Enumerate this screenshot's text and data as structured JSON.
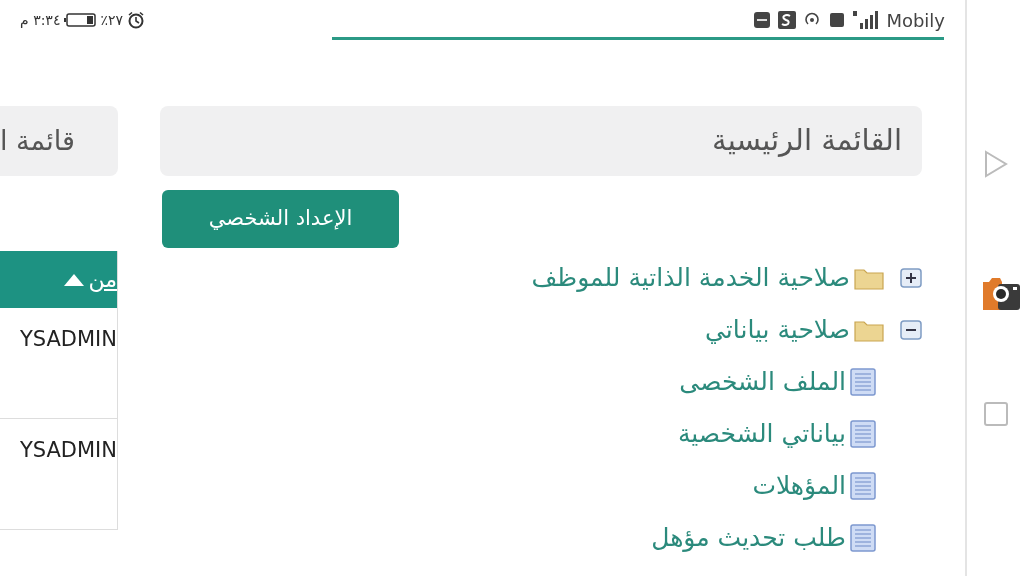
{
  "status_bar": {
    "time": "٣:٣٤ م",
    "battery": "٪٢٧",
    "carrier": "Mobily"
  },
  "left_panel": {
    "title": "قائمة ا",
    "table": {
      "columns": [
        {
          "label": "من",
          "sort_ascending": true
        }
      ],
      "rows": [
        {
          "cells": [
            "YSADMIN"
          ]
        },
        {
          "cells": [
            "YSADMIN"
          ]
        }
      ]
    }
  },
  "main_menu": {
    "title": "القائمة الرئيسية",
    "button": "الإعداد الشخصي",
    "tree": [
      {
        "label": "صلاحية الخدمة الذاتية للموظف",
        "kind": "folder",
        "expanded": false
      },
      {
        "label": "صلاحية بياناتي",
        "kind": "folder",
        "expanded": true,
        "children": [
          {
            "label": "الملف الشخصى",
            "kind": "page"
          },
          {
            "label": "بياناتي الشخصية",
            "kind": "page"
          },
          {
            "label": "المؤهلات",
            "kind": "page"
          },
          {
            "label": "طلب تحديث مؤهل",
            "kind": "page"
          }
        ]
      }
    ]
  }
}
